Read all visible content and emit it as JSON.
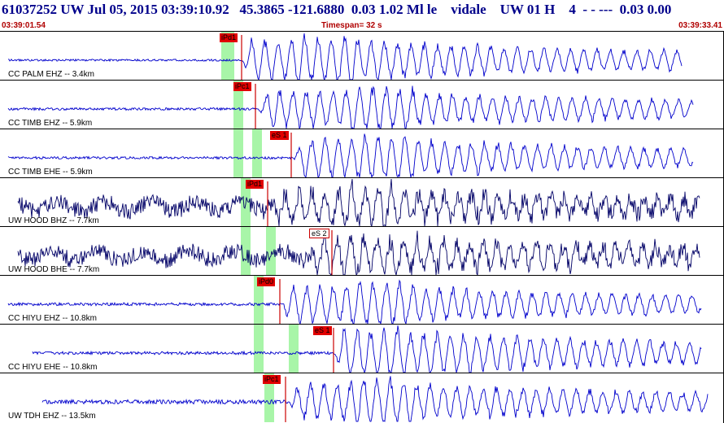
{
  "header": {
    "event_id": "61037252",
    "network": "UW",
    "datetime": "Jul 05, 2015 03:39:10.92",
    "lat": "45.3865",
    "lon": "-121.6880",
    "depth": "0.03",
    "magnitude": "1.02 Ml le",
    "analyst": "vidale",
    "region": "UW 01 H",
    "count": "4",
    "tail": "- - ---  0.03 0.00"
  },
  "time_bar": {
    "start": "03:39:01.54",
    "timespan": "Timespan=  32 s",
    "end": "03:39:33.41"
  },
  "colors": {
    "title": "#00008b",
    "time_bar_text": "#b00000",
    "trace_ehz": "#0000cc",
    "trace_bhz": "#000066",
    "pick_bar": "#cc0000",
    "window": "#a8f5a8"
  },
  "traces": [
    {
      "label": "CC PALM EHZ -- 3.4km",
      "color": "#0000cc",
      "pick": "iPd1",
      "s_pick": ""
    },
    {
      "label": "CC TIMB EHZ -- 5.9km",
      "color": "#0000cc",
      "pick": "iPc1",
      "s_pick": ""
    },
    {
      "label": "CC TIMB EHE -- 5.9km",
      "color": "#0000cc",
      "pick": "",
      "s_pick": "eS 1"
    },
    {
      "label": "UW HOOD BHZ -- 7.7km",
      "color": "#000066",
      "pick": "iPd1",
      "s_pick": ""
    },
    {
      "label": "UW HOOD BHE -- 7.7km",
      "color": "#000066",
      "pick": "",
      "s_pick": "eS 2"
    },
    {
      "label": "CC HIYU EHZ -- 10.8km",
      "color": "#0000cc",
      "pick": "iPd0",
      "s_pick": ""
    },
    {
      "label": "CC HIYU EHE -- 10.8km",
      "color": "#0000cc",
      "pick": "",
      "s_pick": "eS 1"
    },
    {
      "label": "UW TDH EHZ -- 13.5km",
      "color": "#0000cc",
      "pick": "iPc1",
      "s_pick": ""
    }
  ]
}
